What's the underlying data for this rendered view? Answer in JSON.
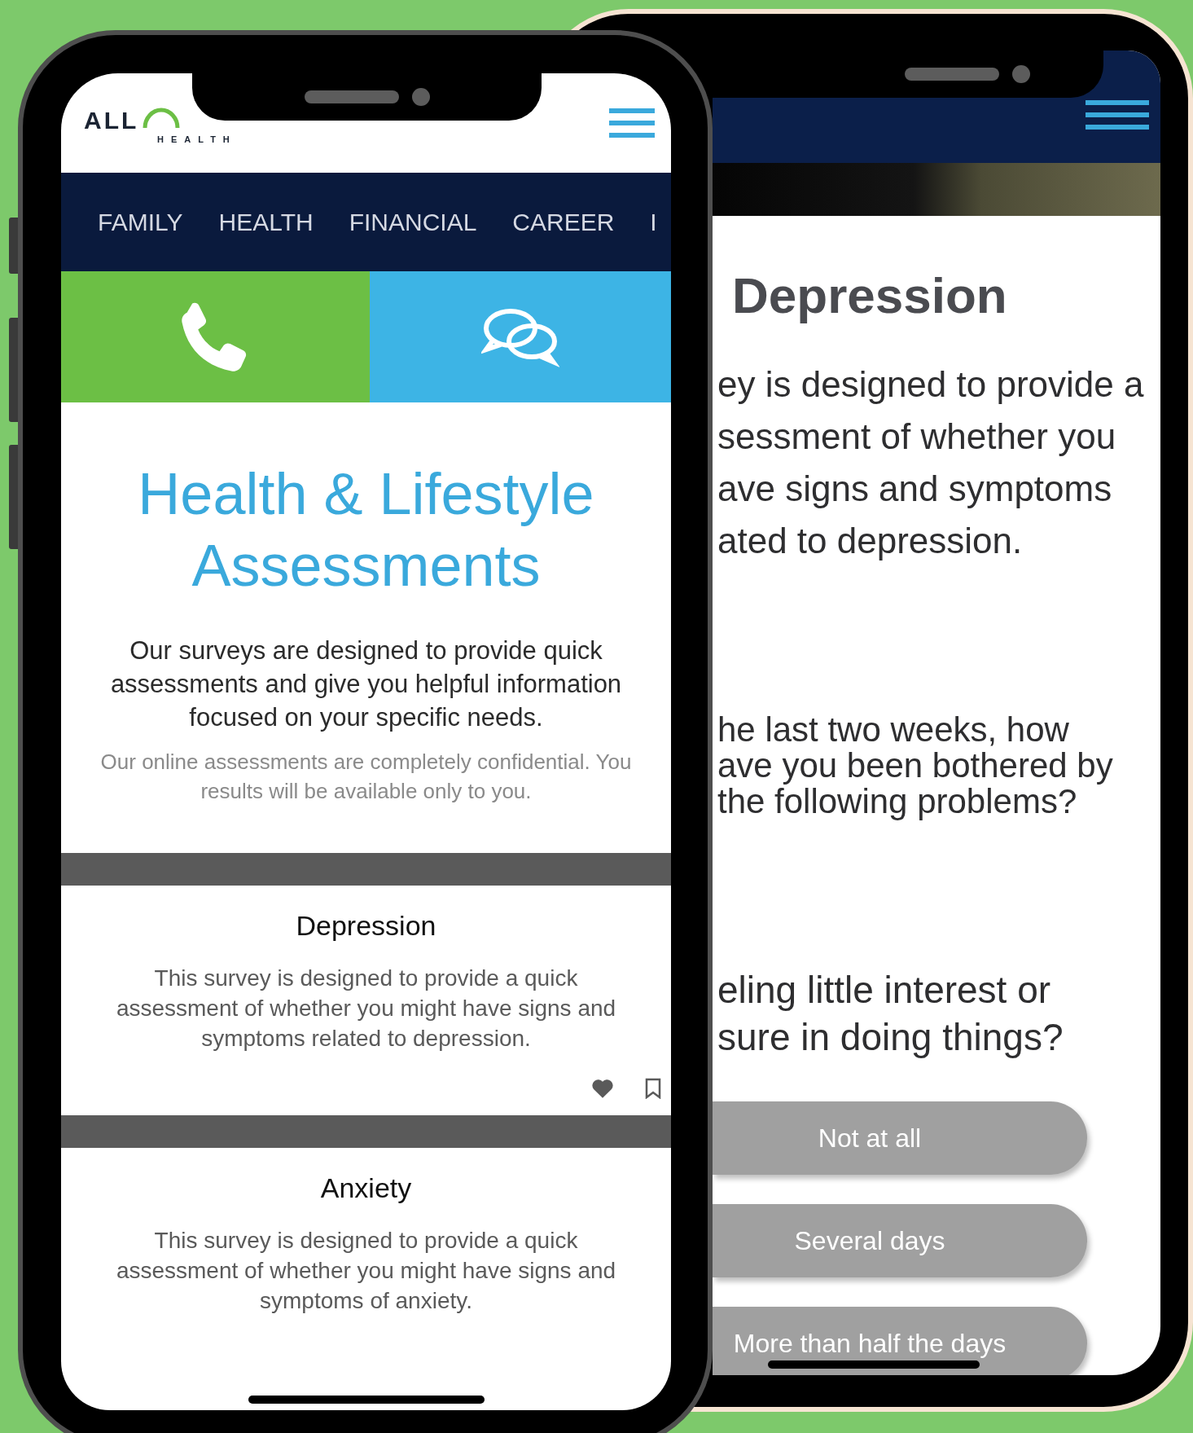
{
  "front_phone": {
    "logo": {
      "wordmark": "ALL",
      "tagline": "HEALTH"
    },
    "nav": [
      {
        "label": "FAMILY"
      },
      {
        "label": "HEALTH"
      },
      {
        "label": "FINANCIAL"
      },
      {
        "label": "CAREER"
      },
      {
        "label": "I"
      }
    ],
    "actions": [
      {
        "kind": "call"
      },
      {
        "kind": "chat"
      }
    ],
    "title_lines": [
      "Health & Lifestyle",
      "Assessments"
    ],
    "intro": "Our surveys are designed to provide quick assessments and give you helpful information focused on your specific needs.",
    "note_lines": [
      "Our online assessments are completely confidential. You",
      "results will be available only to you."
    ],
    "surveys": [
      {
        "title": "Depression",
        "description": "This survey is designed to provide a quick assessment of whether you might have signs and symptoms related to depression.",
        "actions_shown": true
      },
      {
        "title": "Anxiety",
        "description": "This survey is designed to provide a quick assessment of whether you might have signs and symptoms of anxiety.",
        "actions_shown": false
      }
    ]
  },
  "back_phone": {
    "title": "Depression",
    "description_lines": [
      "ey is designed to provide a",
      "sessment of whether you",
      "ave signs and symptoms",
      "ated to depression."
    ],
    "intro_question_lines": [
      "he last two weeks, how",
      "ave you been bothered by",
      "the following problems?"
    ],
    "question_lines": [
      "eling little interest or",
      "sure in doing things?"
    ],
    "answers": [
      {
        "label": "Not at all"
      },
      {
        "label": "Several days"
      },
      {
        "label": "More than half the days"
      }
    ]
  }
}
